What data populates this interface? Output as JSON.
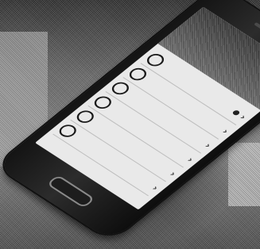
{
  "photo": {
    "subject": "smartphone"
  },
  "app": {
    "header_title": "",
    "menu_items": [
      {
        "label": "",
        "icon": "circle-icon",
        "has_badge": true
      },
      {
        "label": "",
        "icon": "circle-icon",
        "has_badge": false
      },
      {
        "label": "",
        "icon": "circle-icon",
        "has_badge": false
      },
      {
        "label": "",
        "icon": "circle-icon",
        "has_badge": false
      },
      {
        "label": "",
        "icon": "circle-icon",
        "has_badge": false
      },
      {
        "label": "",
        "icon": "circle-icon",
        "has_badge": false
      }
    ],
    "chevron": "›",
    "footer": ""
  }
}
